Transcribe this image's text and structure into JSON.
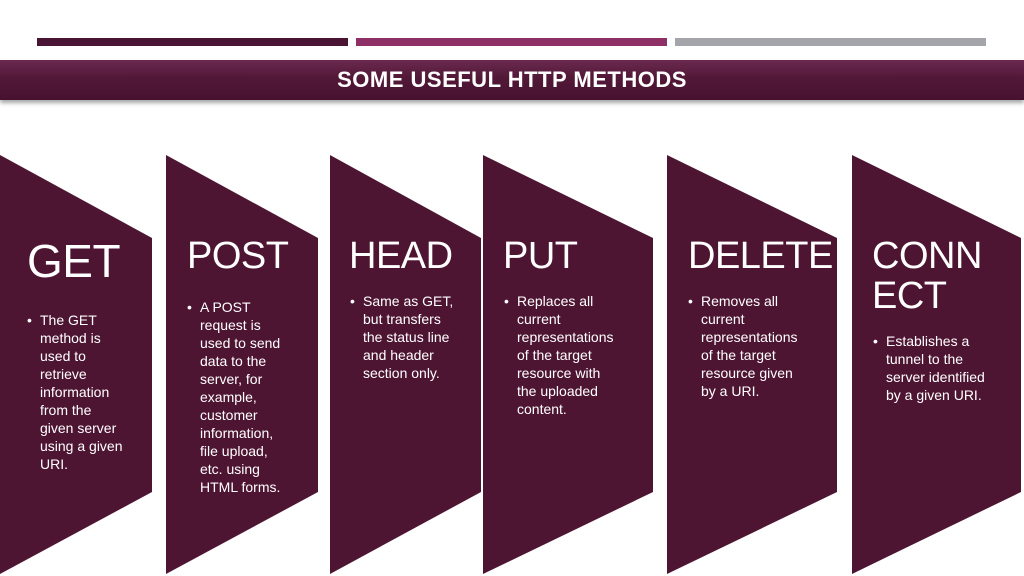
{
  "header": {
    "bar_colors": [
      "#4a1535",
      "#8e2f66",
      "#a3a5aa"
    ],
    "title": "SOME USEFUL HTTP METHODS"
  },
  "colors": {
    "panel": "#4e1533",
    "text": "#ffffff"
  },
  "bullet_glyph": "•",
  "methods": [
    {
      "name": "GET",
      "description": "The GET\nmethod is\nused to\nretrieve\ninformation\nfrom the\ngiven server\nusing a given\nURI."
    },
    {
      "name": "POST",
      "description": "A POST\nrequest is\nused to send\ndata to the\nserver, for\nexample,\ncustomer\ninformation,\nfile upload,\netc. using\nHTML forms."
    },
    {
      "name": "HEAD",
      "description": "Same as GET,\nbut transfers\nthe status line\nand header\nsection only."
    },
    {
      "name": "PUT",
      "description": "Replaces all\ncurrent\nrepresentations\nof the target\nresource with\nthe uploaded\ncontent."
    },
    {
      "name": "DELETE",
      "description": "Removes all\ncurrent\nrepresentations\nof the target\nresource given\nby a URI."
    },
    {
      "name": "CONN\nECT",
      "description": "Establishes a\ntunnel to the\nserver identified\nby a given URI."
    }
  ]
}
